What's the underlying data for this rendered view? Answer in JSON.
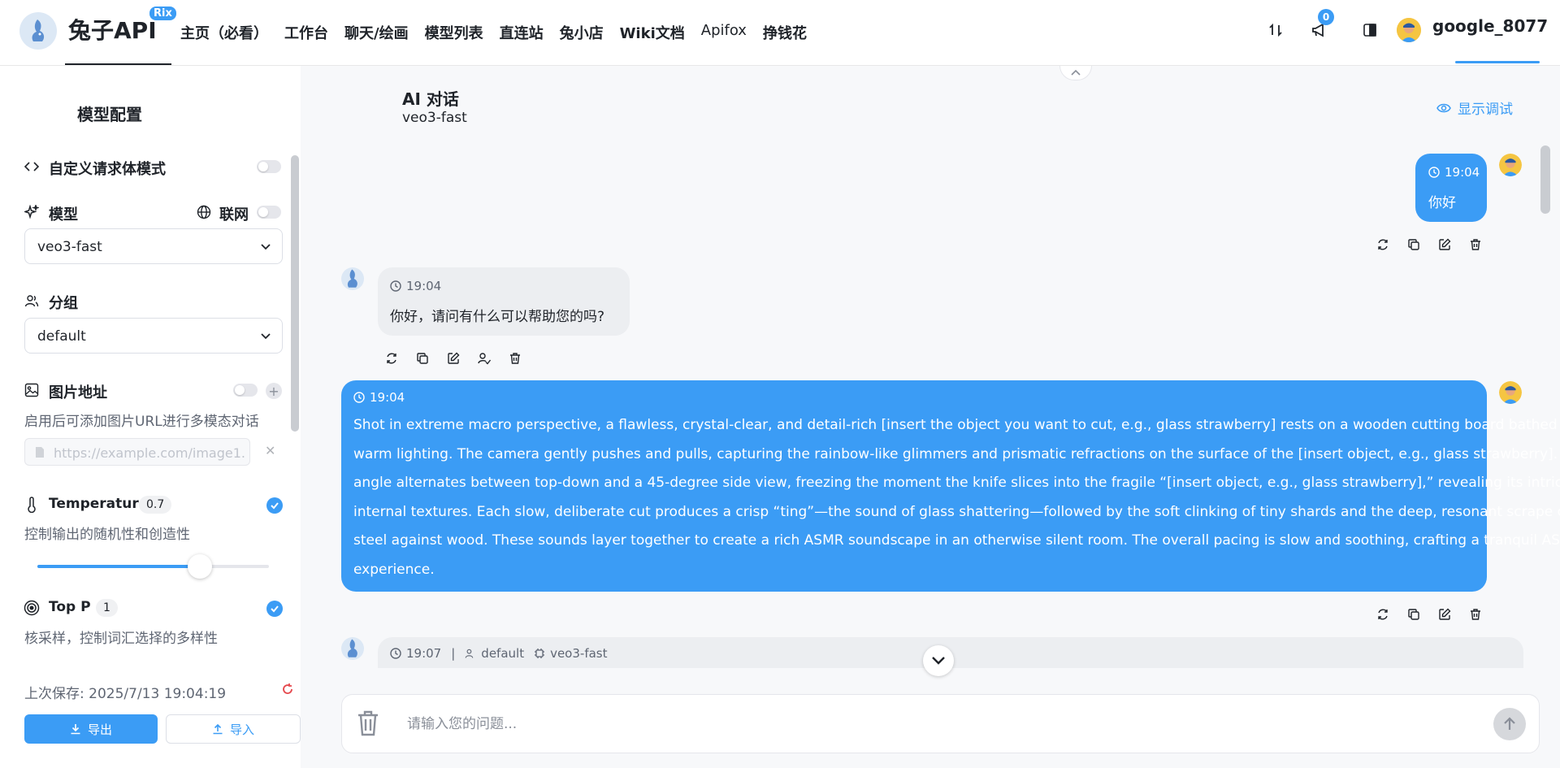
{
  "header": {
    "brand": "兔子API",
    "brand_badge": "Rix",
    "nav": [
      "主页（必看）",
      "工作台",
      "聊天/绘画",
      "模型列表",
      "直连站",
      "兔小店",
      "Wiki文档",
      "Apifox",
      "挣钱花"
    ],
    "notification_count": "0",
    "username": "google_8077"
  },
  "sidebar": {
    "title": "模型配置",
    "custom_body_label": "自定义请求体模式",
    "model_label": "模型",
    "web_label": "联网",
    "model_value": "veo3-fast",
    "group_label": "分组",
    "group_value": "default",
    "image_url_label": "图片地址",
    "image_url_desc": "启用后可添加图片URL进行多模态对话",
    "image_url_placeholder": "https://example.com/image1.",
    "temperature_label": "Temperature",
    "temperature_value": "0.7",
    "temperature_desc": "控制输出的随机性和创造性",
    "top_p_label": "Top P",
    "top_p_value": "1",
    "top_p_desc": "核采样，控制词汇选择的多样性",
    "last_save": "上次保存: 2025/7/13 19:04:19",
    "export_label": "导出",
    "import_label": "导入"
  },
  "chat": {
    "title": "AI 对话",
    "subtitle": "veo3-fast",
    "debug_label": "显示调试",
    "messages": [
      {
        "role": "user",
        "time": "19:04",
        "text": "你好"
      },
      {
        "role": "assistant",
        "time": "19:04",
        "text": "你好，请问有什么可以帮助您的吗?"
      },
      {
        "role": "user",
        "time": "19:04",
        "lines": [
          "Shot in extreme macro perspective, a flawless, crystal-clear, and detail-rich [insert the object you want to cut, e.g., glass strawberry] rests on a wooden cutting board bathed in",
          "warm lighting. The camera gently pushes and pulls, capturing the rainbow-like glimmers and prismatic refractions on the surface of the [insert object, e.g., glass strawberry]. The",
          "angle alternates between top-down and a 45-degree side view, freezing the moment the knife slices into the fragile “[insert object, e.g., glass strawberry],” revealing its intricate",
          "internal textures. Each slow, deliberate cut produces a crisp “ting”—the sound of glass shattering—followed by the soft clinking of tiny shards and the deep, resonant scrape of",
          "steel against wood. These sounds layer together to create a rich ASMR soundscape in an otherwise silent room. The overall pacing is slow and soothing, crafting a tranquil ASMR",
          "experience."
        ]
      },
      {
        "role": "assistant",
        "time": "19:07",
        "group": "default",
        "model": "veo3-fast"
      }
    ],
    "input_placeholder": "请输入您的问题..."
  },
  "levels": {
    "temperature_fraction": 0.7
  }
}
